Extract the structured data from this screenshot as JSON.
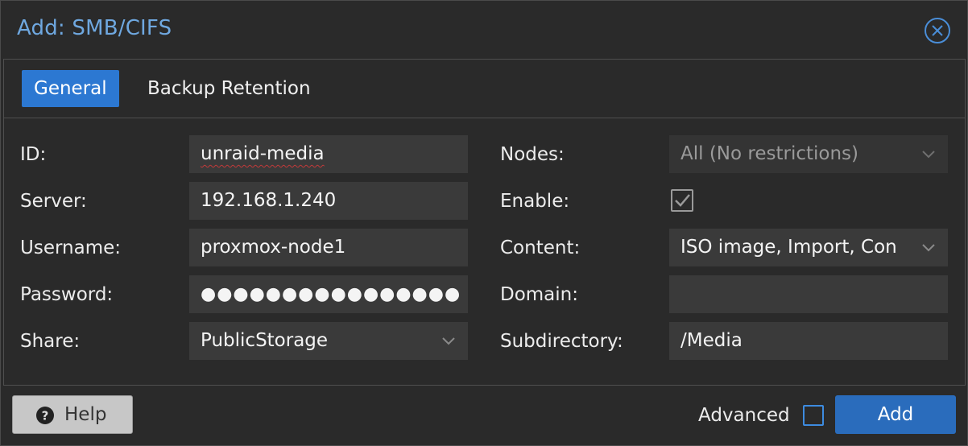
{
  "dialog": {
    "title": "Add: SMB/CIFS",
    "close_icon": "close-circle-icon"
  },
  "tabs": [
    {
      "label": "General",
      "active": true
    },
    {
      "label": "Backup Retention",
      "active": false
    }
  ],
  "left": {
    "id": {
      "label": "ID:",
      "value": "unraid-media"
    },
    "server": {
      "label": "Server:",
      "value": "192.168.1.240"
    },
    "username": {
      "label": "Username:",
      "value": "proxmox-node1"
    },
    "password": {
      "label": "Password:",
      "value": "●●●●●●●●●●●●●●●●"
    },
    "share": {
      "label": "Share:",
      "value": "PublicStorage"
    }
  },
  "right": {
    "nodes": {
      "label": "Nodes:",
      "value": "All (No restrictions)"
    },
    "enable": {
      "label": "Enable:",
      "checked": true
    },
    "content": {
      "label": "Content:",
      "value": "ISO image, Import, Con"
    },
    "domain": {
      "label": "Domain:",
      "value": ""
    },
    "subdirectory": {
      "label": "Subdirectory:",
      "value": "/Media"
    }
  },
  "footer": {
    "help_label": "Help",
    "advanced_label": "Advanced",
    "advanced_checked": false,
    "add_label": "Add"
  },
  "colors": {
    "accent": "#2c78d2",
    "title": "#6fa8e0",
    "background": "#2a2a2a",
    "field": "#3a3a3a"
  }
}
